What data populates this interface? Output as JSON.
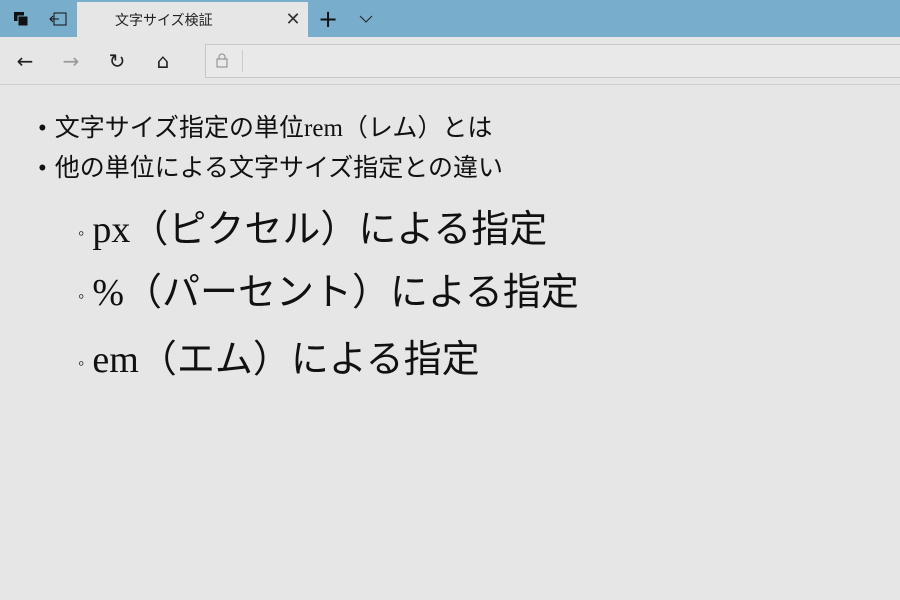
{
  "browser": {
    "tab_title": "文字サイズ検証",
    "new_tab": "+",
    "tab_list": "⌵",
    "close": "✕",
    "back": "←",
    "forward": "→",
    "refresh": "↻",
    "home": "⌂"
  },
  "content": {
    "items": [
      "文字サイズ指定の単位rem（レム）とは",
      "他の単位による文字サイズ指定との違い"
    ],
    "subitems": [
      "px（ピクセル）による指定",
      "%（パーセント）による指定",
      "em（エム）による指定"
    ],
    "sub_bullet": "◦"
  }
}
